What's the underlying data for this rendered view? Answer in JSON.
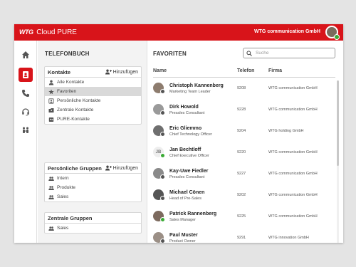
{
  "header": {
    "logo": "WTG",
    "app_name": "Cloud PURE",
    "company": "WTG communication GmbH"
  },
  "rail": {
    "items": [
      {
        "icon": "home-icon",
        "active": false
      },
      {
        "icon": "contacts-icon",
        "active": true
      },
      {
        "icon": "phone-icon",
        "active": false
      },
      {
        "icon": "headset-icon",
        "active": false
      },
      {
        "icon": "team-icon",
        "active": false
      }
    ]
  },
  "phonebook": {
    "title": "TELEFONBUCH",
    "add_label": "Hinzufügen",
    "contacts": {
      "title": "Kontakte",
      "items": [
        {
          "icon": "person-icon",
          "label": "Alle Kontakte"
        },
        {
          "icon": "star-icon",
          "label": "Favoriten"
        },
        {
          "icon": "personal-contacts-icon",
          "label": "Persönliche Kontakte"
        },
        {
          "icon": "central-contacts-icon",
          "label": "Zentrale Kontakte"
        },
        {
          "icon": "pure-contacts-icon",
          "label": "PURE-Kontakte"
        }
      ]
    },
    "personal_groups": {
      "title": "Persönliche Gruppen",
      "items": [
        {
          "icon": "group-icon",
          "label": "Intern"
        },
        {
          "icon": "group-icon",
          "label": "Produkte"
        },
        {
          "icon": "group-icon",
          "label": "Sales"
        }
      ]
    },
    "central_groups": {
      "title": "Zentrale Gruppen",
      "items": [
        {
          "icon": "group-icon",
          "label": "Sales"
        }
      ]
    }
  },
  "favorites": {
    "title": "FAVORITEN",
    "search_placeholder": "Suche",
    "columns": {
      "name": "Name",
      "phone": "Telefon",
      "company": "Firma"
    },
    "rows": [
      {
        "name": "Christoph Kannenberg",
        "role": "Marketing Team Leader",
        "phone": "9208",
        "company": "WTG communication GmbH",
        "status": "away",
        "initials": ""
      },
      {
        "name": "Dirk Howold",
        "role": "Presales Consultant",
        "phone": "9228",
        "company": "WTG communication GmbH",
        "status": "away",
        "initials": ""
      },
      {
        "name": "Eric Gliemmo",
        "role": "Chief Technology Officer",
        "phone": "9204",
        "company": "WTG holding GmbH",
        "status": "away",
        "initials": ""
      },
      {
        "name": "Jan Bechtloff",
        "role": "Chief Executive Officer",
        "phone": "9220",
        "company": "WTG communication GmbH",
        "status": "online",
        "initials": "JB"
      },
      {
        "name": "Kay-Uwe Fiedler",
        "role": "Presales Consultant",
        "phone": "9227",
        "company": "WTG communication GmbH",
        "status": "away",
        "initials": ""
      },
      {
        "name": "Michael Cönen",
        "role": "Head of Pre-Sales",
        "phone": "9202",
        "company": "WTG communication GmbH",
        "status": "away",
        "initials": ""
      },
      {
        "name": "Patrick Rannenberg",
        "role": "Sales Manager",
        "phone": "9225",
        "company": "WTG communication GmbH",
        "status": "online",
        "initials": ""
      },
      {
        "name": "Paul Muster",
        "role": "Product Owner",
        "phone": "9291",
        "company": "WTG innovation GmbH",
        "status": "away",
        "initials": ""
      }
    ]
  },
  "colors": {
    "brand": "#d8141a",
    "online": "#3aaa35",
    "away": "#555555"
  }
}
